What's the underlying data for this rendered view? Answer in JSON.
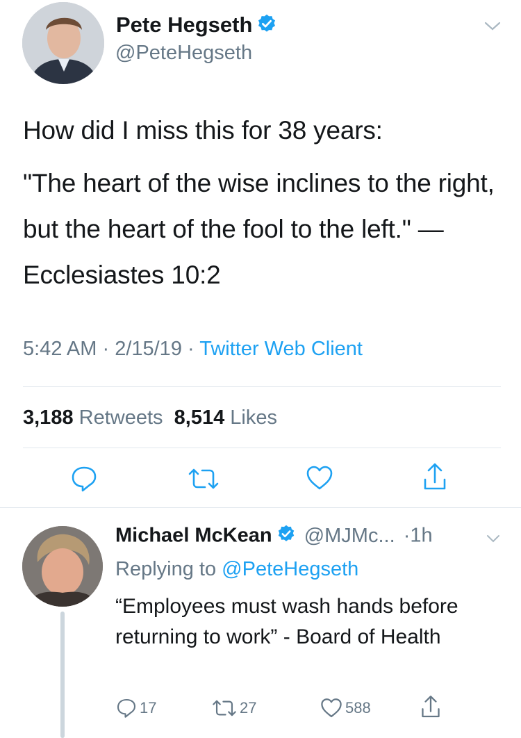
{
  "tweet": {
    "author_name": "Pete Hegseth",
    "author_handle": "@PeteHegseth",
    "text_line1": "How did I miss this for 38 years:",
    "text_line2": "\"The heart of the wise inclines to the right, but the heart of the fool to the left.\" —Ecclesiastes 10:2",
    "time": "5:42 AM",
    "date": "2/15/19",
    "source": "Twitter Web Client",
    "retweets_count": "3,188",
    "retweets_label": "Retweets",
    "likes_count": "8,514",
    "likes_label": "Likes"
  },
  "reply": {
    "author_name": "Michael McKean",
    "author_handle": "@MJMc...",
    "age": "1h",
    "replying_prefix": "Replying to",
    "replying_to": "@PeteHegseth",
    "text": "“Employees must wash hands before returning to work” - Board of Health",
    "replies_count": "17",
    "retweets_count": "27",
    "likes_count": "588"
  },
  "colors": {
    "accent": "#1da1f2",
    "secondary_text": "#657786",
    "icon": "#1da1f2",
    "divider": "#e1e8ed"
  },
  "icons": [
    "verified-badge-icon",
    "chevron-down-icon",
    "reply-icon",
    "retweet-icon",
    "like-icon",
    "share-icon"
  ]
}
